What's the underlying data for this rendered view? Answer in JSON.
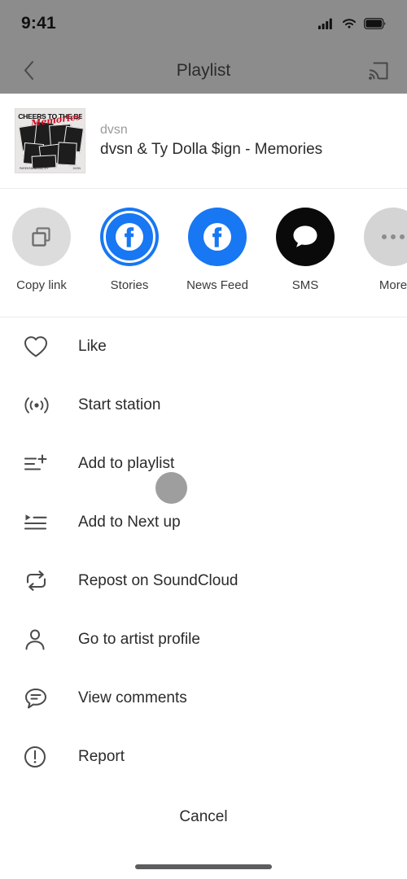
{
  "status_bar": {
    "time": "9:41",
    "cellular_icon": "cellular-signal-icon",
    "wifi_icon": "wifi-icon",
    "battery_icon": "battery-full-icon"
  },
  "nav": {
    "back_icon": "back-chevron-icon",
    "title": "Playlist",
    "cast_icon": "cast-icon"
  },
  "track": {
    "username": "dvsn",
    "title": "dvsn & Ty Dolla $ign - Memories",
    "artwork": {
      "headline": "CHEERS TO THE BEST",
      "script": "Memories",
      "footer_left": "PARENTAL ADVISORY",
      "footer_right": "DVSN"
    }
  },
  "share": {
    "items": [
      {
        "label": "Copy link",
        "icon": "copy-link-icon",
        "circle_color": "#dcdcdc",
        "glyph_color": "#6e6e6e"
      },
      {
        "label": "Stories",
        "icon": "facebook-stories-icon",
        "circle_color": "#1877f2",
        "glyph_color": "#ffffff"
      },
      {
        "label": "News Feed",
        "icon": "facebook-icon",
        "circle_color": "#1877f2",
        "glyph_color": "#ffffff"
      },
      {
        "label": "SMS",
        "icon": "sms-message-icon",
        "circle_color": "#0a0a0a",
        "glyph_color": "#ffffff"
      },
      {
        "label": "More",
        "icon": "more-ellipsis-icon",
        "circle_color": "#d4d4d4",
        "glyph_color": "#8d8d8d"
      }
    ]
  },
  "menu": {
    "items": [
      {
        "label": "Like",
        "icon": "heart-icon"
      },
      {
        "label": "Start station",
        "icon": "radio-station-icon"
      },
      {
        "label": "Add to playlist",
        "icon": "add-to-playlist-icon"
      },
      {
        "label": "Add to Next up",
        "icon": "add-to-next-up-icon"
      },
      {
        "label": "Repost on SoundCloud",
        "icon": "repost-icon"
      },
      {
        "label": "Go to artist profile",
        "icon": "user-profile-icon"
      },
      {
        "label": "View comments",
        "icon": "comment-bubble-icon"
      },
      {
        "label": "Report",
        "icon": "report-exclamation-icon"
      }
    ]
  },
  "footer": {
    "cancel_label": "Cancel",
    "home_indicator": "home-indicator"
  },
  "colors": {
    "facebook_blue": "#1877f2",
    "overlay_gray": "#8c8c8c",
    "text_primary": "#2b2b2b",
    "text_muted": "#9b9b9b",
    "divider": "#ececee"
  }
}
